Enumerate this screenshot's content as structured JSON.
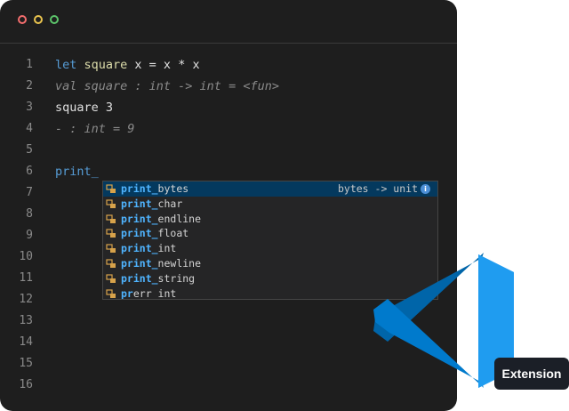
{
  "editor": {
    "lines": [
      {
        "n": "1",
        "parts": [
          [
            "kw",
            "let "
          ],
          [
            "fn",
            "square"
          ],
          [
            "plain",
            " x = x * x"
          ]
        ]
      },
      {
        "n": "2",
        "parts": [
          [
            "cm",
            "val square : int -> int = <fun>"
          ]
        ]
      },
      {
        "n": "3",
        "parts": [
          [
            "plain",
            "square 3"
          ]
        ]
      },
      {
        "n": "4",
        "parts": [
          [
            "cm",
            "- : int = 9"
          ]
        ]
      },
      {
        "n": "5",
        "parts": []
      },
      {
        "n": "6",
        "parts": [
          [
            "id",
            "print_"
          ]
        ]
      },
      {
        "n": "7",
        "parts": []
      },
      {
        "n": "8",
        "parts": []
      },
      {
        "n": "9",
        "parts": []
      },
      {
        "n": "10",
        "parts": []
      },
      {
        "n": "11",
        "parts": []
      },
      {
        "n": "12",
        "parts": []
      },
      {
        "n": "13",
        "parts": []
      },
      {
        "n": "14",
        "parts": []
      },
      {
        "n": "15",
        "parts": []
      },
      {
        "n": "16",
        "parts": []
      }
    ]
  },
  "suggestions": {
    "items": [
      {
        "match": "print_",
        "rest": "bytes",
        "detail": "bytes -> unit",
        "selected": true
      },
      {
        "match": "print_",
        "rest": "char",
        "detail": "",
        "selected": false
      },
      {
        "match": "print_",
        "rest": "endline",
        "detail": "",
        "selected": false
      },
      {
        "match": "print_",
        "rest": "float",
        "detail": "",
        "selected": false
      },
      {
        "match": "print_",
        "rest": "int",
        "detail": "",
        "selected": false
      },
      {
        "match": "print_",
        "rest": "newline",
        "detail": "",
        "selected": false
      },
      {
        "match": "print_",
        "rest": "string",
        "detail": "",
        "selected": false
      },
      {
        "match": "pr",
        "rest": "err_int",
        "detail": "",
        "selected": false
      }
    ],
    "icon": "method-cube-icon",
    "info_icon": "info-icon"
  },
  "badge": {
    "label": "Extension"
  },
  "colors": {
    "accent": "#1f8ad2",
    "selection": "#04395e",
    "editor_bg": "#1e1e1e"
  }
}
